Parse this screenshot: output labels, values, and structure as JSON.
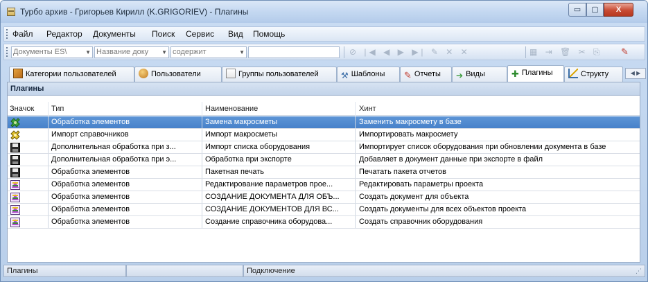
{
  "window": {
    "title": "Турбо архив - Григорьев Кирилл (K.GRIGORIEV) - Плагины",
    "min_label": "▭",
    "max_label": "▢",
    "close_label": "X"
  },
  "menu": [
    "Файл",
    "Редактор",
    "Документы",
    "Поиск",
    "Сервис",
    "Вид",
    "Помощь"
  ],
  "toolbar": {
    "combo1": "Документы ES\\",
    "combo2": "Название доку",
    "combo3": "содержит"
  },
  "tabs": [
    {
      "label": "Категории пользователей",
      "icon": "categories-icon",
      "active": false
    },
    {
      "label": "Пользователи",
      "icon": "users-icon",
      "active": false
    },
    {
      "label": "Группы пользователей",
      "icon": "groups-icon",
      "active": false
    },
    {
      "label": "Шаблоны",
      "icon": "templates-icon",
      "active": false
    },
    {
      "label": "Отчеты",
      "icon": "reports-icon",
      "active": false
    },
    {
      "label": "Виды",
      "icon": "views-icon",
      "active": false
    },
    {
      "label": "Плагины",
      "icon": "plugins-icon",
      "active": true
    },
    {
      "label": "Структу",
      "icon": "structure-icon",
      "active": false
    }
  ],
  "panel": {
    "title": "Плагины",
    "columns": [
      "Значок",
      "Тип",
      "Наименование",
      "Хинт"
    ],
    "rows": [
      {
        "icon": "green-gear-icon",
        "type": "Обработка элементов",
        "name": "Замена макросметы",
        "hint": "Заменить макросмету в базе",
        "selected": true
      },
      {
        "icon": "yellow-gear-icon",
        "type": "Импорт справочников",
        "name": "Импорт макросметы",
        "hint": "Импортировать макросмету",
        "selected": false
      },
      {
        "icon": "floppy-icon",
        "type": "Дополнительная обработка при з...",
        "name": "Импорт списка оборудования",
        "hint": "Импортирует список оборудования при обновлении документа в базе",
        "selected": false
      },
      {
        "icon": "floppy-icon",
        "type": "Дополнительная обработка при э...",
        "name": "Обработка при экспорте",
        "hint": "Добавляет в документ данные при экспорте в файл",
        "selected": false
      },
      {
        "icon": "floppy-icon",
        "type": "Обработка элементов",
        "name": "Пакетная печать",
        "hint": "Печатать пакета отчетов",
        "selected": false
      },
      {
        "icon": "plugin-script-icon",
        "type": "Обработка элементов",
        "name": "Редактирование параметров прое...",
        "hint": "Редактировать параметры проекта",
        "selected": false
      },
      {
        "icon": "plugin-script-icon",
        "type": "Обработка элементов",
        "name": "СОЗДАНИЕ ДОКУМЕНТА ДЛЯ ОБЪ...",
        "hint": "Создать документ для объекта",
        "selected": false
      },
      {
        "icon": "plugin-script-icon",
        "type": "Обработка элементов",
        "name": "СОЗДАНИЕ ДОКУМЕНТОВ ДЛЯ ВС...",
        "hint": "Создать документы для всех объектов проекта",
        "selected": false
      },
      {
        "icon": "plugin-script-icon",
        "type": "Обработка элементов",
        "name": "Создание справочника оборудова...",
        "hint": "Создать справочник оборудования",
        "selected": false
      }
    ]
  },
  "status": {
    "left": "Плагины",
    "middle": "",
    "right": "Подключение"
  }
}
